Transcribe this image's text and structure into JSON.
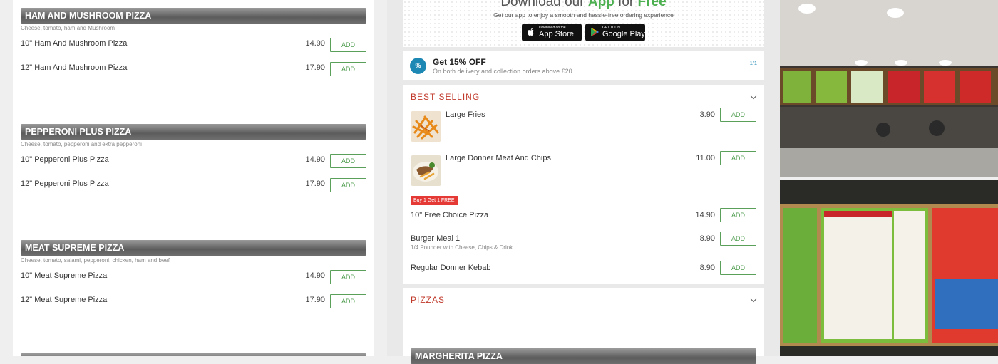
{
  "left": {
    "categories": [
      {
        "title": "HAM AND MUSHROOM PIZZA",
        "description": "Cheese, tomato, ham and Mushroom",
        "items": [
          {
            "name": "10\" Ham And Mushroom Pizza",
            "price": "14.90"
          },
          {
            "name": "12\" Ham And Mushroom Pizza",
            "price": "17.90"
          }
        ]
      },
      {
        "title": "PEPPERONI PLUS PIZZA",
        "description": "Cheese, tomato, pepperoni and extra pepperoni",
        "items": [
          {
            "name": "10\" Pepperoni Plus Pizza",
            "price": "14.90"
          },
          {
            "name": "12\" Pepperoni Plus Pizza",
            "price": "17.90"
          }
        ]
      },
      {
        "title": "MEAT SUPREME PIZZA",
        "description": "Cheese, tomato, salami, pepperoni, chicken, ham and beef",
        "items": [
          {
            "name": "10\" Meat Supreme Pizza",
            "price": "14.90"
          },
          {
            "name": "12\" Meat Supreme Pizza",
            "price": "17.90"
          }
        ]
      }
    ],
    "add_label": "ADD"
  },
  "app_banner": {
    "title_prefix": "Download our ",
    "title_app": "App",
    "title_middle": " for ",
    "title_free": "Free",
    "subtitle": "Get our app to enjoy a smooth and hassle-free ordering experience",
    "appstore_small": "Download on the",
    "appstore_big": "App Store",
    "play_small": "GET IT ON",
    "play_big": "Google Play"
  },
  "promo": {
    "icon_text": "%",
    "title": "Get 15% OFF",
    "subtitle": "On both delivery and collection orders above £20",
    "page": "1/1"
  },
  "best_selling": {
    "title": "BEST SELLING",
    "items": [
      {
        "name": "Large Fries",
        "price": "3.90"
      },
      {
        "name": "Large Donner Meat And Chips",
        "price": "11.00"
      },
      {
        "badge": "Buy 1 Get 1 FREE",
        "name": "10\" Free Choice Pizza",
        "price": "14.90"
      },
      {
        "name": "Burger Meal 1",
        "description": "1/4 Pounder with Cheese, Chips & Drink",
        "price": "8.90"
      },
      {
        "name": "Regular Donner Kebab",
        "price": "8.90"
      }
    ]
  },
  "pizzas": {
    "title": "PIZZAS",
    "first_category": "MARGHERITA PIZZA"
  },
  "colors": {
    "accent_green": "#4caf50",
    "section_red": "#c0392b",
    "badge_red": "#e53935",
    "promo_blue": "#1e88b4"
  }
}
